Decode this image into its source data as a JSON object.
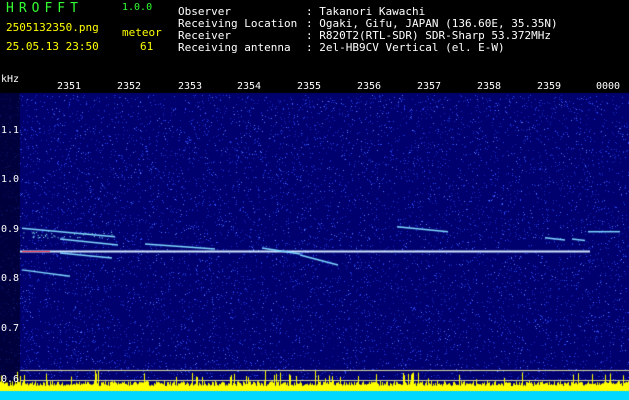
{
  "app": {
    "name": "HROFFT",
    "version": "1.0.0"
  },
  "image": {
    "filename": "2505132350.png",
    "timestamp": "25.05.13 23:50",
    "event_label": "meteor",
    "event_count": "61"
  },
  "info": [
    {
      "label": "Observer",
      "value": ": Takanori Kawachi"
    },
    {
      "label": "Receiving Location",
      "value": ": Ogaki, Gifu, JAPAN (136.60E, 35.35N)"
    },
    {
      "label": "Receiver",
      "value": ": R820T2(RTL-SDR) SDR-Sharp 53.372MHz"
    },
    {
      "label": "Receiving antenna",
      "value": ": 2el-HB9CV Vertical (el. E-W)"
    }
  ],
  "spectrogram": {
    "unit": "kHz",
    "time_labels": [
      "2351",
      "2352",
      "2353",
      "2354",
      "2355",
      "2356",
      "2357",
      "2358",
      "2359",
      "0000"
    ],
    "freq_labels": [
      "1.1",
      "1.0",
      "0.9",
      "0.8",
      "0.7",
      "0.6"
    ],
    "carrier_khz": 0.855,
    "colors": {
      "background": "#00006e",
      "carrier": "#cfe8ff",
      "trail": "#7fd8ff",
      "histogram_base": "#00d8ff",
      "histogram_peaks": "#ffff00"
    }
  }
}
